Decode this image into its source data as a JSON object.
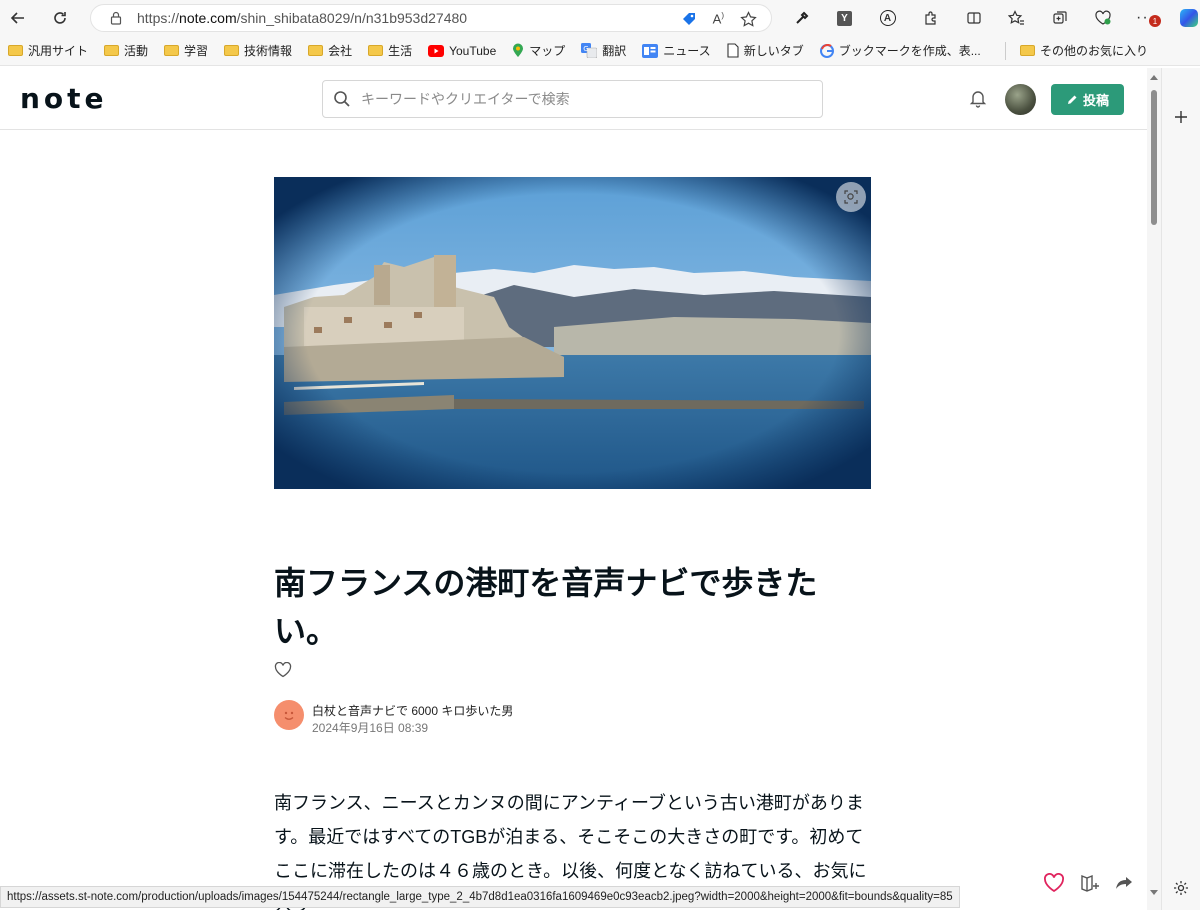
{
  "browser": {
    "url_prefix": "https://",
    "url_host": "note.com",
    "url_path": "/shin_shibata8029/n/n31b953d27480",
    "notification_badge": "1"
  },
  "bookmarks": [
    {
      "label": "汎用サイト",
      "icon": "folder-icon"
    },
    {
      "label": "活動",
      "icon": "folder-icon"
    },
    {
      "label": "学習",
      "icon": "folder-icon"
    },
    {
      "label": "技術情報",
      "icon": "folder-icon"
    },
    {
      "label": "会社",
      "icon": "folder-icon"
    },
    {
      "label": "生活",
      "icon": "folder-icon"
    },
    {
      "label": "YouTube",
      "icon": "youtube-icon"
    },
    {
      "label": "マップ",
      "icon": "maps-pin-icon"
    },
    {
      "label": "翻訳",
      "icon": "translate-icon"
    },
    {
      "label": "ニュース",
      "icon": "news-icon"
    },
    {
      "label": "新しいタブ",
      "icon": "page-icon"
    },
    {
      "label": "ブックマークを作成、表...",
      "icon": "google-icon"
    }
  ],
  "other_bookmarks": "その他のお気に入り",
  "note": {
    "logo": "note",
    "search_placeholder": "キーワードやクリエイターで検索",
    "post_button": "投稿"
  },
  "article": {
    "title": "南フランスの港町を音声ナビで歩きたい。",
    "author": "白杖と音声ナビで 6000 キロ歩いた男",
    "date": "2024年9月16日 08:39",
    "body": " 南フランス、ニースとカンヌの間にアンティーブという古い港町があります。最近ではすべてのTGBが泊まる、そこそこの大きさの町です。初めてここに滞在したのは４６歳のとき。以後、何度となく訪ねている、お気に入り"
  },
  "status_url": "https://assets.st-note.com/production/uploads/images/154475244/rectangle_large_type_2_4b7d8d1ea0316fa1609469e0c93eacb2.jpeg?width=2000&height=2000&fit=bounds&quality=85",
  "colors": {
    "accent": "#2c9a79",
    "heart": "#e0245e",
    "author_avatar": "#f58e6d"
  }
}
